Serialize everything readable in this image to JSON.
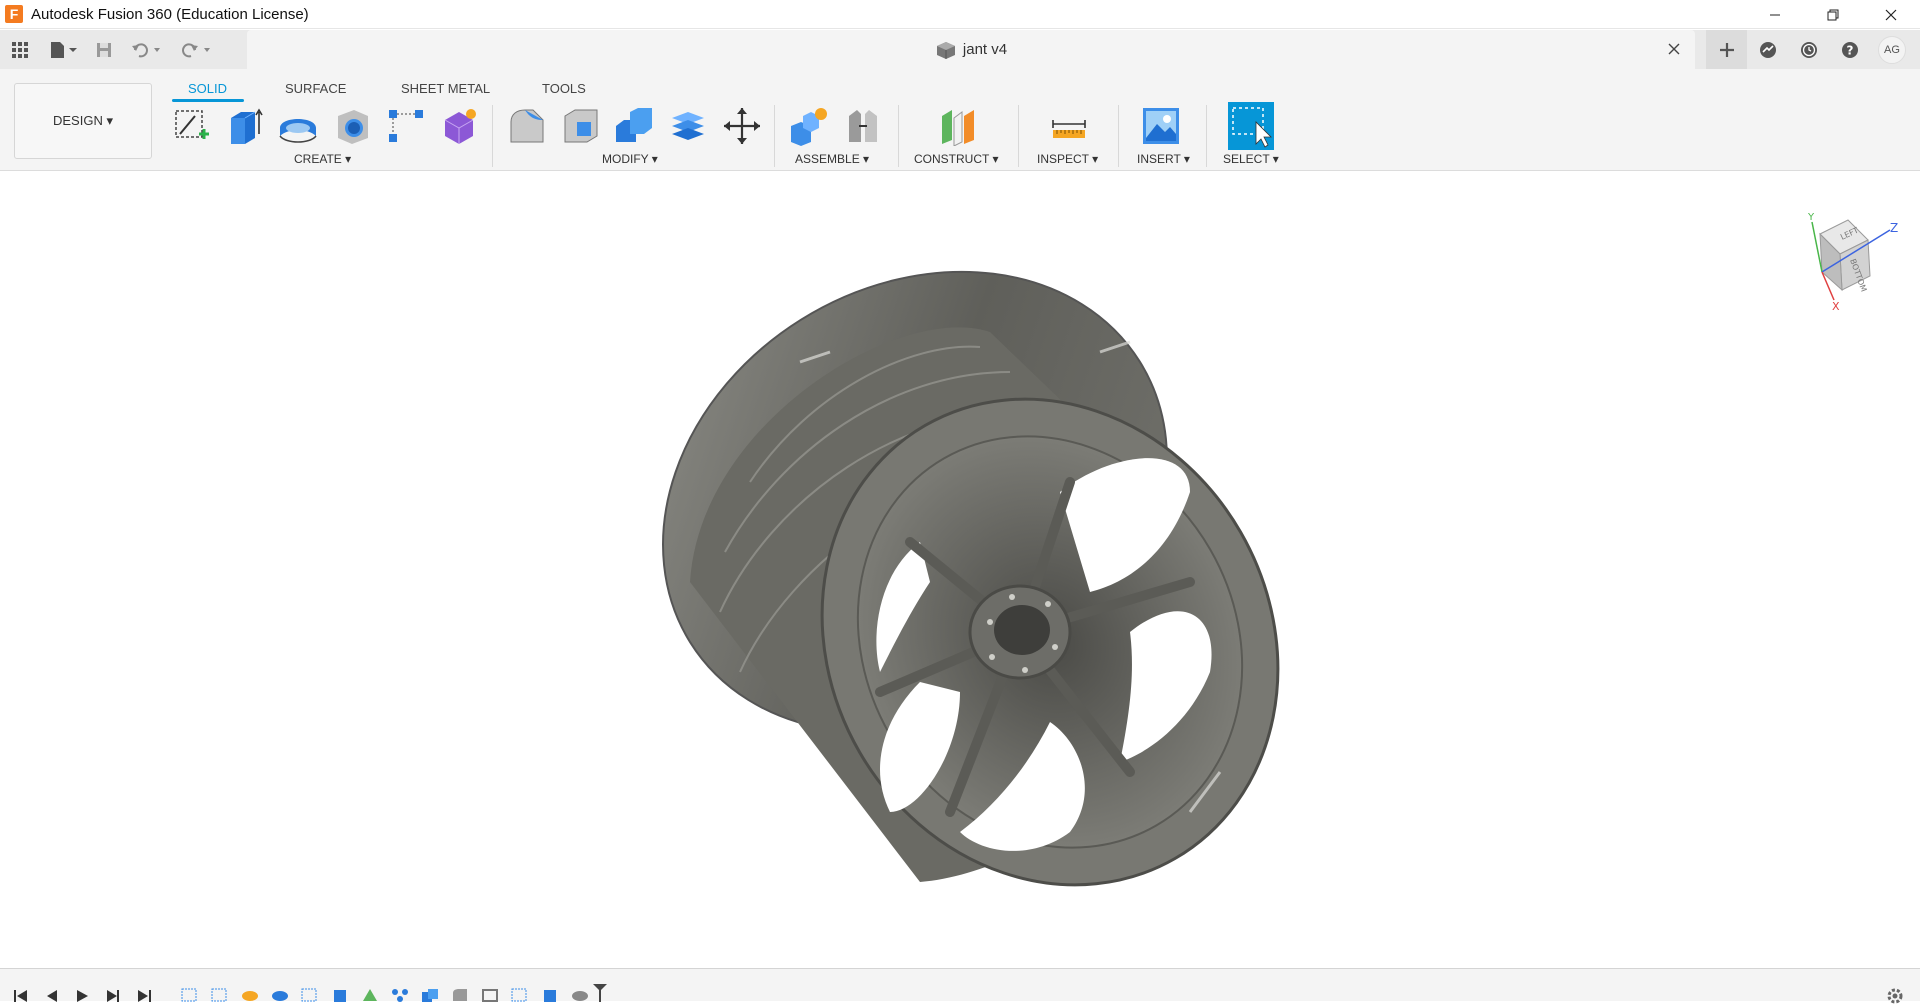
{
  "window": {
    "title": "Autodesk Fusion 360 (Education License)",
    "logo_letter": "F"
  },
  "document": {
    "title": "jant v4"
  },
  "user": {
    "initials": "AG"
  },
  "ribbon": {
    "workspace": "DESIGN ▾",
    "tabs": [
      {
        "label": "SOLID",
        "active": true
      },
      {
        "label": "SURFACE",
        "active": false
      },
      {
        "label": "SHEET METAL",
        "active": false
      },
      {
        "label": "TOOLS",
        "active": false
      }
    ],
    "groups": {
      "create": "CREATE ▾",
      "modify": "MODIFY ▾",
      "assemble": "ASSEMBLE ▾",
      "construct": "CONSTRUCT ▾",
      "inspect": "INSPECT ▾",
      "insert": "INSERT ▾",
      "select": "SELECT ▾"
    }
  },
  "viewcube": {
    "faces": {
      "top": "LEFT",
      "front": "BOTTOM"
    },
    "axes": {
      "x": "X",
      "y": "Y",
      "z": "Z"
    }
  },
  "colors": {
    "accent": "#0696d7",
    "model": "#6b6b66",
    "ribbon_bg": "#f4f4f4"
  }
}
